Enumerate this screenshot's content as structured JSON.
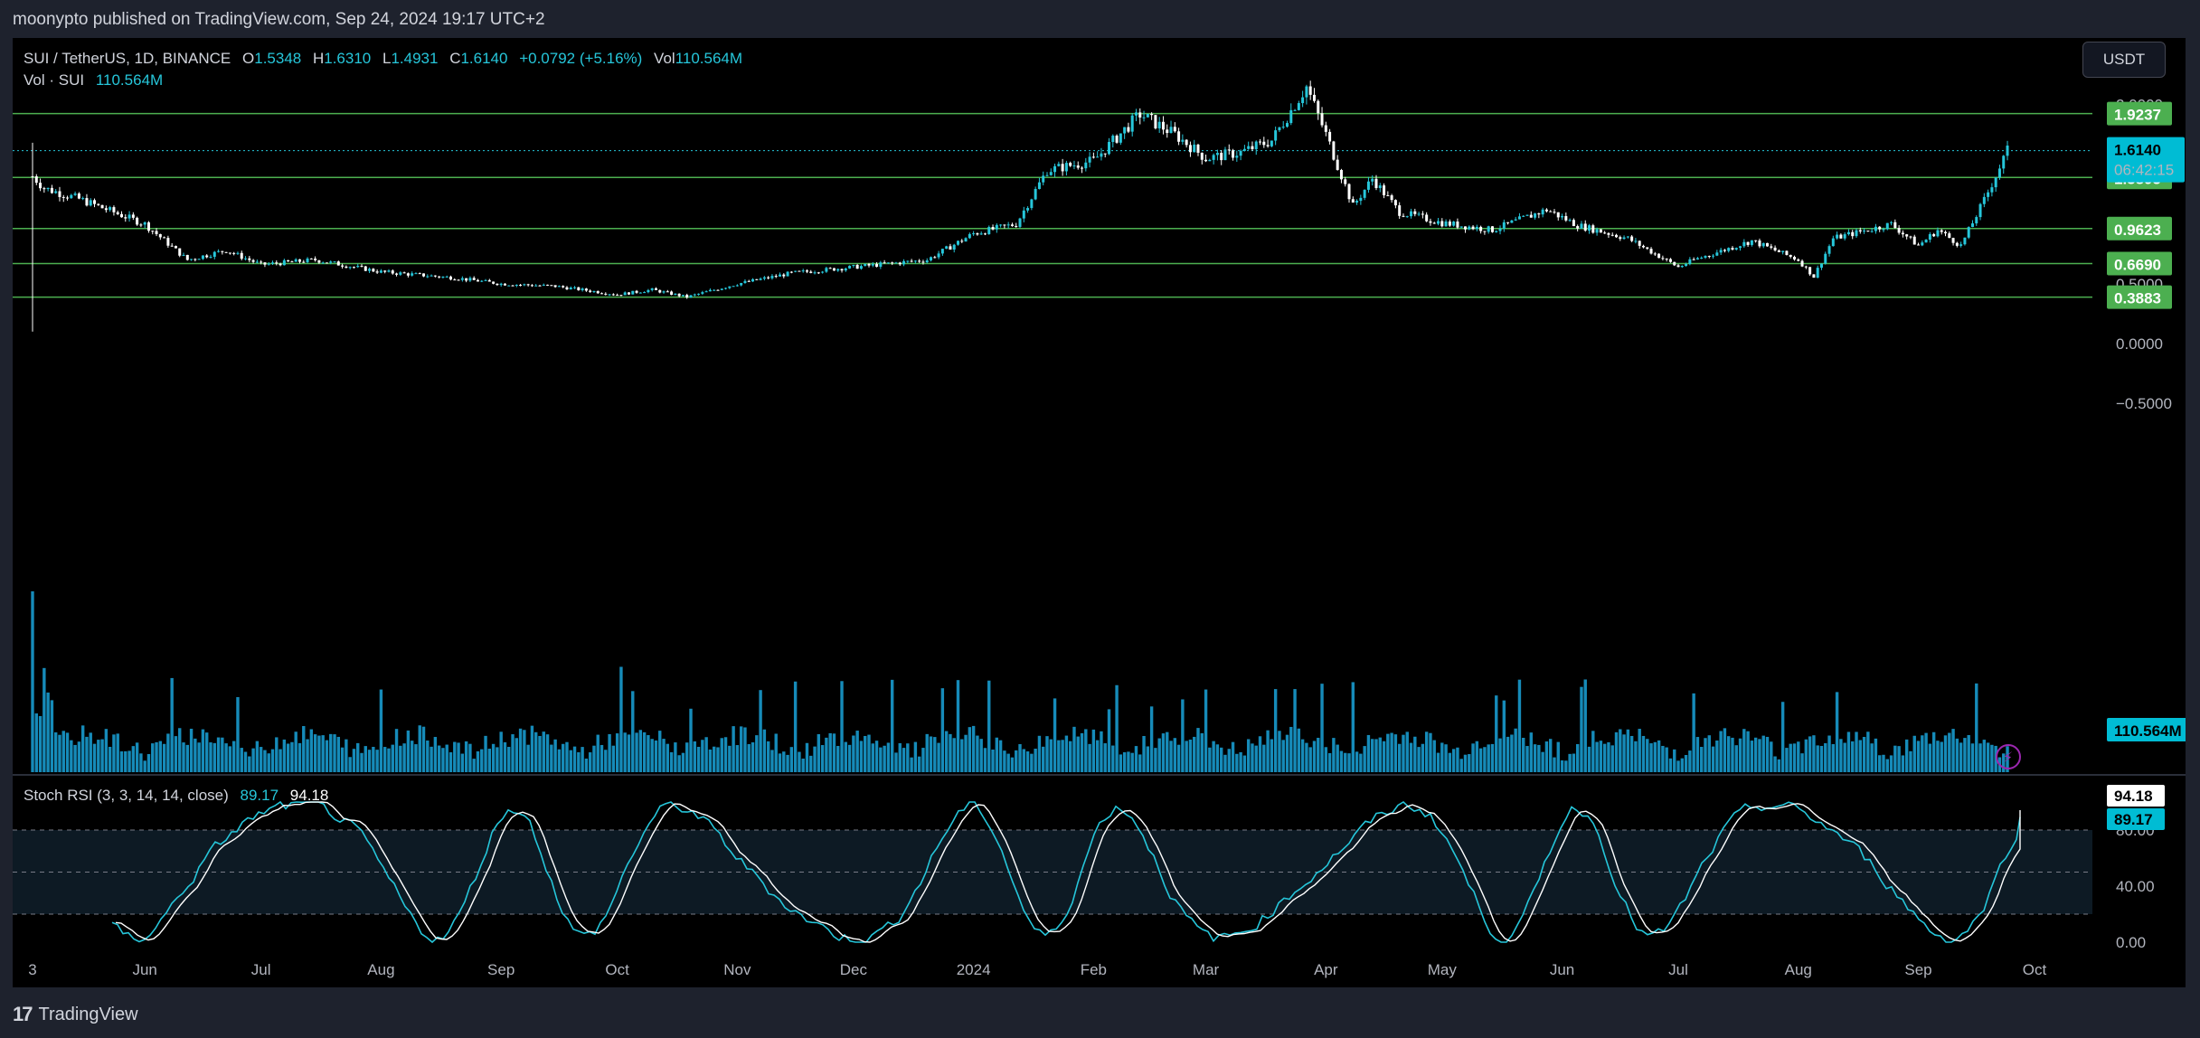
{
  "header": {
    "published_text": "moonypto published on TradingView.com, Sep 24, 2024 19:17 UTC+2"
  },
  "legend": {
    "symbol": "SUI / TetherUS, 1D, BINANCE",
    "open_label": "O",
    "open": "1.5348",
    "high_label": "H",
    "high": "1.6310",
    "low_label": "L",
    "low": "1.4931",
    "close_label": "C",
    "close": "1.6140",
    "change": "+0.0792 (+5.16%)",
    "vol_label": "Vol",
    "vol": "110.564M",
    "vol_line_label": "Vol · SUI",
    "vol_line_value": "110.564M"
  },
  "currency_button": "USDT",
  "stoch_rsi": {
    "label": "Stoch RSI (3, 3, 14, 14, close)",
    "k_value": "89.17",
    "d_value": "94.18"
  },
  "footer": {
    "brand": "TradingView",
    "brand_mark": "17"
  },
  "colors": {
    "background": "#000000",
    "frame": "#1e222d",
    "up": "#26c6da",
    "down": "#ffffff",
    "volume": "#1aa3d9",
    "support_line": "#4caf50",
    "badge_green": "#4caf50",
    "badge_price": "#00bcd4"
  },
  "chart_data": [
    {
      "type": "candlestick",
      "symbol": "SUI / TetherUS",
      "interval": "1D",
      "exchange": "BINANCE",
      "x_tick_labels": [
        "3",
        "Jun",
        "Jul",
        "Aug",
        "Sep",
        "Oct",
        "Nov",
        "Dec",
        "2024",
        "Feb",
        "Mar",
        "Apr",
        "May",
        "Jun",
        "Jul",
        "Aug",
        "Sep",
        "Oct"
      ],
      "y_tick_labels": [
        "2.0000",
        "0.5000",
        "0.0000",
        "−0.5000"
      ],
      "ylim": [
        -0.75,
        2.35
      ],
      "close_path": {
        "x": [
          "May 3 2023",
          "May 6 2023",
          "May 15 2023",
          "Jun 1 2023",
          "Jun 12 2023",
          "Jun 22 2023",
          "Jul 1 2023",
          "Jul 15 2023",
          "Aug 1 2023",
          "Aug 20 2023",
          "Sep 1 2023",
          "Sep 15 2023",
          "Oct 1 2023",
          "Oct 10 2023",
          "Oct 19 2023",
          "Nov 1 2023",
          "Nov 15 2023",
          "Dec 1 2023",
          "Dec 20 2023",
          "Jan 1 2024",
          "Jan 12 2024",
          "Jan 20 2024",
          "Feb 1 2024",
          "Feb 13 2024",
          "Feb 22 2024",
          "Mar 1 2024",
          "Mar 10 2024",
          "Mar 18 2024",
          "Mar 27 2024",
          "Apr 1 2024",
          "Apr 8 2024",
          "Apr 13 2024",
          "Apr 20 2024",
          "May 1 2024",
          "May 14 2024",
          "May 28 2024",
          "Jun 5 2024",
          "Jun 18 2024",
          "Jul 1 2024",
          "Jul 5 2024",
          "Jul 20 2024",
          "Aug 1 2024",
          "Aug 5 2024",
          "Aug 10 2024",
          "Aug 25 2024",
          "Sep 1 2024",
          "Sep 6 2024",
          "Sep 12 2024",
          "Sep 18 2024",
          "Sep 24 2024"
        ],
        "close": [
          1.4,
          1.3,
          1.21,
          1.0,
          0.7,
          0.78,
          0.66,
          0.7,
          0.6,
          0.55,
          0.5,
          0.48,
          0.41,
          0.45,
          0.39,
          0.5,
          0.59,
          0.64,
          0.7,
          0.92,
          1.0,
          1.45,
          1.53,
          1.92,
          1.75,
          1.55,
          1.6,
          1.7,
          2.15,
          1.75,
          1.15,
          1.38,
          1.1,
          1.01,
          0.95,
          1.12,
          0.99,
          0.88,
          0.64,
          0.7,
          0.86,
          0.7,
          0.56,
          0.88,
          1.0,
          0.82,
          0.95,
          0.82,
          1.2,
          1.614
        ]
      },
      "price_levels": [
        1.9237,
        1.3895,
        0.9623,
        0.669,
        0.3883
      ],
      "last_price": 1.614,
      "countdown": "06:42:15",
      "volume_last": "110.564M"
    },
    {
      "type": "line",
      "name": "Stoch RSI (3, 3, 14, 14, close)",
      "ylim": [
        0,
        100
      ],
      "y_tick_labels": [
        "0.00",
        "40.00",
        "80.00"
      ],
      "bands": {
        "upper": 80,
        "middle": 50,
        "lower": 20
      },
      "series": [
        {
          "name": "K",
          "last": 89.17
        },
        {
          "name": "D",
          "last": 94.18
        }
      ]
    }
  ]
}
